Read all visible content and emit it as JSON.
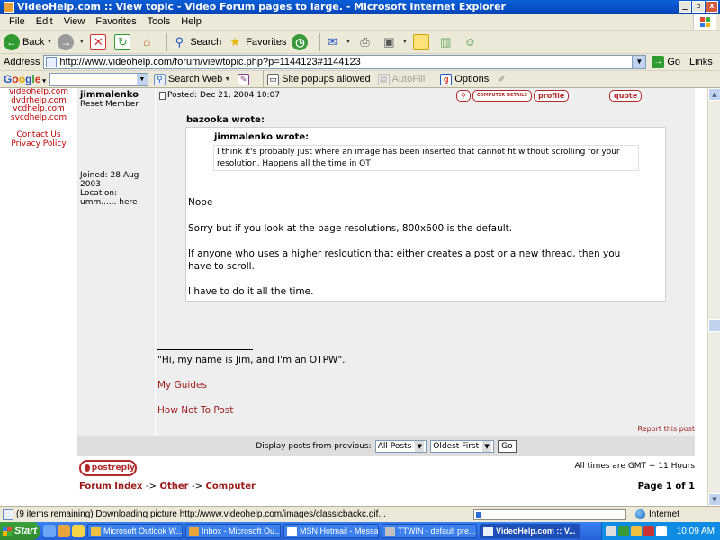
{
  "window": {
    "title": "VideoHelp.com :: View topic - Video Forum pages to large. - Microsoft Internet Explorer",
    "minimize": "_",
    "restore": "▫",
    "close": "x"
  },
  "menu": [
    "File",
    "Edit",
    "View",
    "Favorites",
    "Tools",
    "Help"
  ],
  "toolbar": {
    "back": "Back",
    "search": "Search",
    "favorites": "Favorites"
  },
  "address": {
    "label": "Address",
    "url": "http://www.videohelp.com/forum/viewtopic.php?p=1144123#1144123",
    "go": "Go",
    "links": "Links"
  },
  "google": {
    "logo": [
      "G",
      "o",
      "o",
      "g",
      "l",
      "e"
    ],
    "search_web": "Search Web",
    "popups": "Site popups allowed",
    "autofill": "AutoFill",
    "options": "Options"
  },
  "left_nav": {
    "sites": [
      "videohelp.com",
      "dvdrhelp.com",
      "vcdhelp.com",
      "svcdhelp.com"
    ],
    "contact": "Contact Us",
    "privacy": "Privacy Policy"
  },
  "post": {
    "author": "jimmalenko",
    "rank": "Reset Member",
    "joined": "Joined: 28 Aug 2003",
    "location": "Location: umm...... here",
    "posted": "Posted: Dec 21, 2004 10:07",
    "buttons": {
      "computer": "COMPUTER DETAILS",
      "profile": "profile",
      "quote": "quote"
    },
    "outer_quote_name": "bazooka wrote:",
    "inner_quote_name": "jimmalenko wrote:",
    "inner_quote_text": "I think it's probably just where an image has been inserted that cannot fit without scrolling for your resolution. Happens all the time in OT",
    "paragraphs": [
      "Nope",
      "Sorry but if you look at the page resolutions, 800x600 is the default.",
      "If anyone who uses a higher resloution that either creates a post or a new thread, then you have to scroll.",
      "I have to do it all the time."
    ],
    "signature": {
      "line": "\"Hi, my name is Jim, and I'm an OTPW\".",
      "link1": "My Guides",
      "link2": "How Not To Post"
    },
    "report": "Report this post"
  },
  "display": {
    "label": "Display posts from previous:",
    "posts_value": "All Posts",
    "order_value": "Oldest First",
    "go": "Go"
  },
  "footer": {
    "postreply": "postreply",
    "timezone": "All times are GMT + 11 Hours",
    "nav": {
      "index": "Forum Index",
      "sep": "->",
      "other": "Other",
      "computer": "Computer"
    },
    "page": "Page 1 of 1"
  },
  "status": {
    "text": "(9 items remaining) Downloading picture http://www.videohelp.com/images/classicbackc.gif...",
    "progress": 0.03,
    "zone": "Internet"
  },
  "taskbar": {
    "start": "Start",
    "tasks": [
      {
        "label": "Microsoft Outlook W...",
        "color": "#f0c040",
        "active": false
      },
      {
        "label": "Inbox - Microsoft Ou...",
        "color": "#e8a33a",
        "active": false
      },
      {
        "label": "MSN Hotmail - Messa...",
        "color": "#ffffff",
        "active": false
      },
      {
        "label": "TTWIN - default pre...",
        "color": "#c0c0c0",
        "active": false
      },
      {
        "label": "VideoHelp.com :: V...",
        "color": "#e9f0fb",
        "active": true
      }
    ],
    "time": "10:09 AM"
  }
}
